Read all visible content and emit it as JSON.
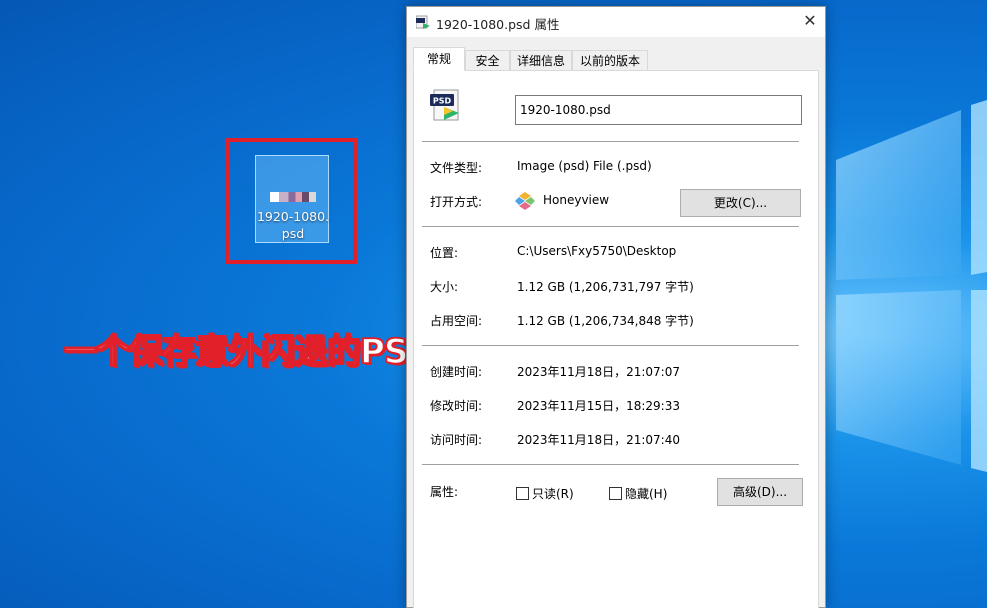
{
  "desktop": {
    "file_icon_label": "1920-1080.psd",
    "caption": "一个保存意外闪退的PSD文件"
  },
  "dialog": {
    "title": "1920-1080.psd 属性",
    "close_glyph": "✕",
    "tabs": [
      "常规",
      "安全",
      "详细信息",
      "以前的版本"
    ],
    "file_name": "1920-1080.psd",
    "file_type_label": "文件类型:",
    "file_type_value": "Image (psd) File (.psd)",
    "open_with_label": "打开方式:",
    "open_with_value": "Honeyview",
    "change_button": "更改(C)...",
    "location_label": "位置:",
    "location_value": "C:\\Users\\Fxy5750\\Desktop",
    "size_label": "大小:",
    "size_value": "1.12 GB (1,206,731,797 字节)",
    "size_on_disk_label": "占用空间:",
    "size_on_disk_value": "1.12 GB (1,206,734,848 字节)",
    "created_label": "创建时间:",
    "created_value": "2023年11月18日，21:07:07",
    "modified_label": "修改时间:",
    "modified_value": "2023年11月15日，18:29:33",
    "accessed_label": "访问时间:",
    "accessed_value": "2023年11月18日，21:07:40",
    "attributes_label": "属性:",
    "readonly_label": "只读(R)",
    "hidden_label": "隐藏(H)",
    "advanced_button": "高级(D)...",
    "psd_badge": "PSD"
  },
  "colors": {
    "highlight": "#e2202a",
    "desktop_blue": "#0a78d8"
  }
}
